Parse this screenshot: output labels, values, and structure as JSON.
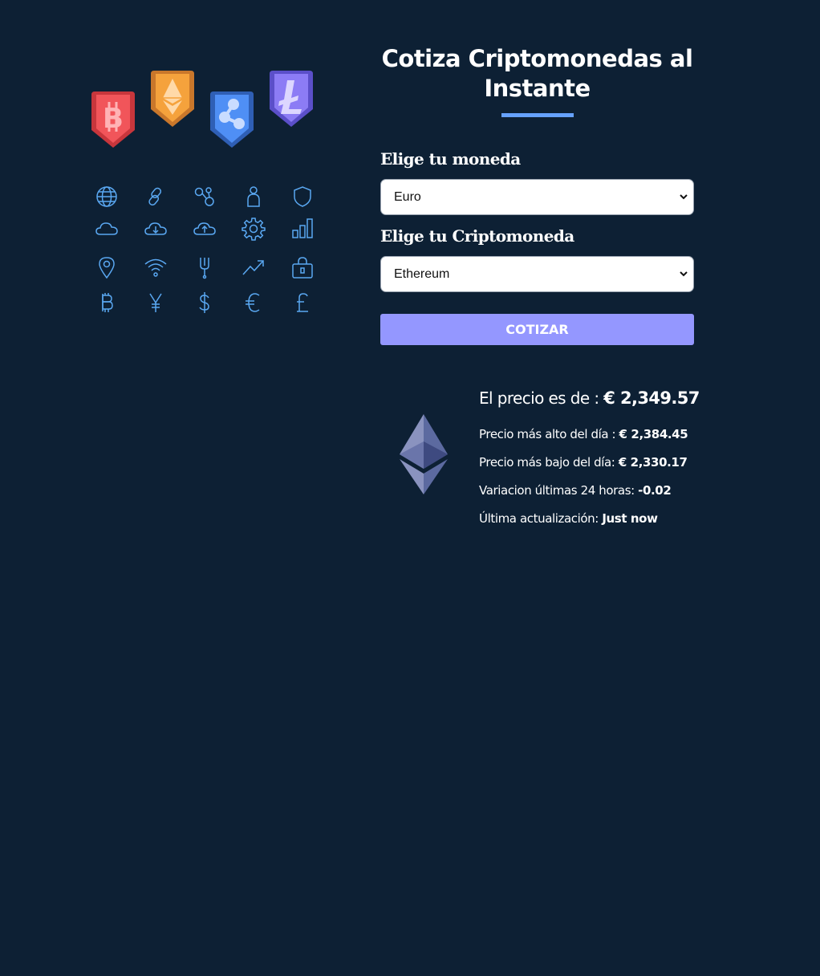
{
  "header": {
    "title": "Cotiza Criptomonedas al Instante"
  },
  "hero": {
    "badges": [
      "bitcoin-icon",
      "ethereum-icon",
      "ripple-icon",
      "litecoin-icon"
    ],
    "badge_colors": [
      "#f1555a",
      "#f5a23c",
      "#4f8ff5",
      "#8c7cf5"
    ],
    "icons": [
      "globe-icon",
      "link-icon",
      "molecule-icon",
      "person-icon",
      "shield-icon",
      "cloud-icon",
      "cloud-download-icon",
      "cloud-upload-icon",
      "gear-icon",
      "bar-chart-icon",
      "map-pin-icon",
      "wifi-icon",
      "fork-icon",
      "trend-up-icon",
      "lock-icon",
      "bitcoin-sign-icon",
      "yen-sign-icon",
      "dollar-sign-icon",
      "euro-sign-icon",
      "pound-sign-icon"
    ],
    "icon_color": "#5aa8f2"
  },
  "form": {
    "currency_label": "Elige tu moneda",
    "currency_value": "Euro",
    "crypto_label": "Elige tu Criptomoneda",
    "crypto_value": "Ethereum",
    "submit_label": "COTIZAR"
  },
  "result": {
    "price_label": "El precio es de :",
    "price_value": "€ 2,349.57",
    "high_label": "Precio más alto del día :",
    "high_value": "€ 2,384.45",
    "low_label": "Precio más bajo del día:",
    "low_value": "€ 2,330.17",
    "change_label": "Variacion últimas 24 horas:",
    "change_value": "-0.02",
    "updated_label": "Última actualización:",
    "updated_value": "Just now"
  },
  "colors": {
    "background": "#0d2034",
    "accent": "#66a2fe",
    "button": "#9497ff"
  }
}
